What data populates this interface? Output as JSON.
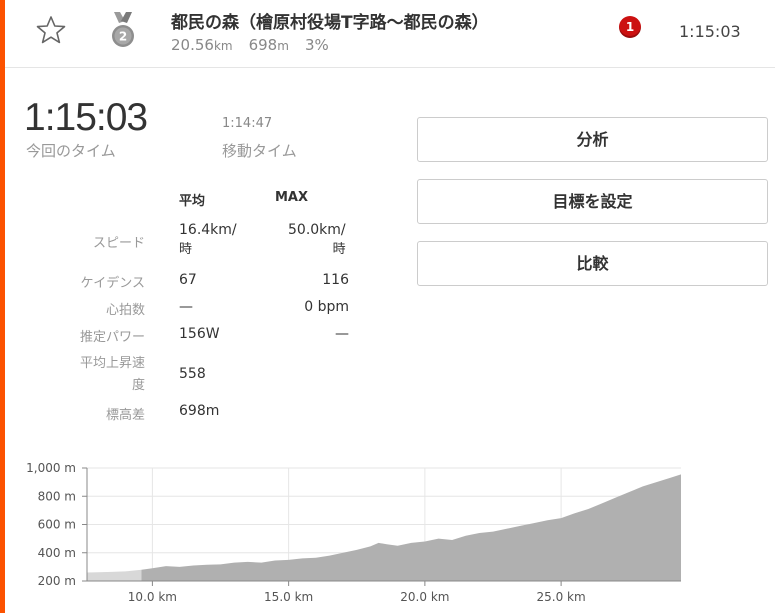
{
  "header": {
    "segment_title": "都民の森（檜原村役場T字路〜都民の森）",
    "distance_value": "20.56",
    "distance_unit": "km",
    "elevation_value": "698",
    "elevation_unit": "m",
    "grade": "3%",
    "medal_rank": "2",
    "notification_count": "1",
    "elapsed_time": "1:15:03",
    "icons": {
      "favorite": "star-outline-icon",
      "medal": "silver-medal-icon"
    }
  },
  "summary": {
    "elapsed_time": "1:15:03",
    "elapsed_label": "今回のタイム",
    "moving_time": "1:14:47",
    "moving_label": "移動タイム"
  },
  "stats": {
    "headers": {
      "avg": "平均",
      "max": "MAX"
    },
    "rows": [
      {
        "label": "スピード",
        "avg_1": "16.4km/",
        "avg_2": "時",
        "max_1": "50.0km/",
        "max_2": "時"
      },
      {
        "label": "ケイデンス",
        "avg": "67",
        "max": "116"
      },
      {
        "label": "心拍数",
        "avg": "—",
        "max": "0 bpm"
      },
      {
        "label": "推定パワー",
        "avg": "156W",
        "max": "—"
      },
      {
        "label_1": "平均上昇速",
        "label_2": "度",
        "avg": "558"
      },
      {
        "label": "標高差",
        "avg": "698m"
      }
    ]
  },
  "buttons": {
    "analyze": "分析",
    "set_goal": "目標を設定",
    "compare": "比較"
  },
  "colors": {
    "accent": "#fc5200",
    "elevation_fill": "#b0b0b0",
    "elevation_fill_light": "#d8d8d8",
    "notification": "#cc1010"
  },
  "chart_data": {
    "type": "area",
    "x_unit": "km",
    "y_unit": "m",
    "xlim": [
      7.6,
      29.4
    ],
    "ylim": [
      200,
      1000
    ],
    "x_ticks": [
      "10.0 km",
      "15.0 km",
      "20.0 km",
      "25.0 km"
    ],
    "x_tick_values": [
      10,
      15,
      20,
      25
    ],
    "y_ticks": [
      "1,000 m",
      "800 m",
      "600 m",
      "400 m",
      "200 m"
    ],
    "y_tick_values": [
      1000,
      800,
      600,
      400,
      200
    ],
    "highlight_start_km": 9.6,
    "x": [
      7.6,
      8.0,
      8.5,
      9.0,
      9.6,
      10.0,
      10.5,
      11.0,
      11.5,
      12.0,
      12.5,
      13.0,
      13.5,
      14.0,
      14.5,
      15.0,
      15.5,
      16.0,
      16.5,
      17.0,
      17.5,
      18.0,
      18.3,
      18.6,
      19.0,
      19.5,
      20.0,
      20.5,
      21.0,
      21.5,
      22.0,
      22.5,
      23.0,
      23.5,
      24.0,
      24.5,
      25.0,
      25.5,
      26.0,
      26.5,
      27.0,
      27.5,
      28.0,
      28.5,
      29.0,
      29.4
    ],
    "y": [
      260,
      262,
      265,
      268,
      280,
      290,
      305,
      300,
      310,
      315,
      318,
      330,
      335,
      330,
      345,
      350,
      360,
      365,
      380,
      400,
      420,
      445,
      470,
      460,
      450,
      470,
      480,
      500,
      490,
      520,
      540,
      550,
      570,
      590,
      610,
      630,
      645,
      680,
      710,
      750,
      790,
      830,
      870,
      900,
      930,
      955
    ]
  }
}
